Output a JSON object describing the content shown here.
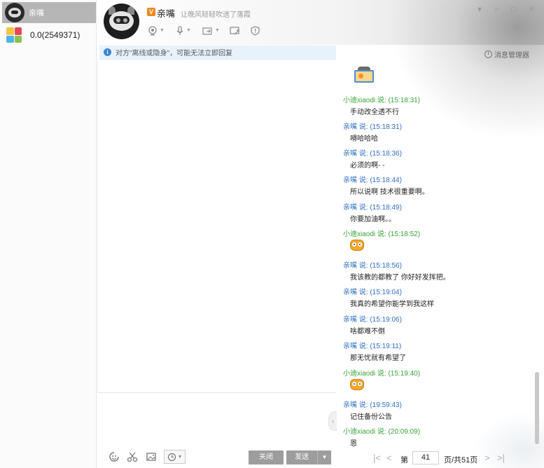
{
  "contacts": [
    {
      "name": "亲嘴",
      "active": true
    },
    {
      "name": "0.0(2549371)",
      "active": false
    }
  ],
  "header": {
    "vip_badge": "V",
    "name": "亲嘴",
    "signature": "让晚风轻轻吹送了落霞"
  },
  "window_controls": {
    "menu": "▾",
    "minimize": "−",
    "maximize": "□",
    "close": "×"
  },
  "notice": {
    "info_glyph": "i",
    "text": "对方\"离线或隐身\"，可能无法立即回复"
  },
  "history_tab": {
    "label": "消息管理器"
  },
  "messages": [
    {
      "sender": "小迪xiaodi 说: (15:18:31)",
      "color": "green",
      "text": "手动改全透不行"
    },
    {
      "sender": "亲嘴 说: (15:18:31)",
      "color": "blue",
      "text": "嘚哈哈哈"
    },
    {
      "sender": "亲嘴 说: (15:18:36)",
      "color": "blue",
      "text": "必须的啊- -"
    },
    {
      "sender": "亲嘴 说: (15:18:44)",
      "color": "blue",
      "text": "所以说啊  技术很重要啊。"
    },
    {
      "sender": "亲嘴 说: (15:18:49)",
      "color": "blue",
      "text": "你要加油啊。。"
    },
    {
      "sender": "小迪xiaodi 说: (15:18:52)",
      "color": "green",
      "emoji": "owl-emoji"
    },
    {
      "sender": "亲嘴 说: (15:18:56)",
      "color": "blue",
      "text": "我该教的都教了  你好好发挥把。"
    },
    {
      "sender": "亲嘴 说: (15:19:04)",
      "color": "blue",
      "text": "我真的希望你能学到我这样"
    },
    {
      "sender": "亲嘴 说: (15:19:06)",
      "color": "blue",
      "text": "啥都难不倒"
    },
    {
      "sender": "亲嘴 说: (15:19:11)",
      "color": "blue",
      "text": "那无忧就有希望了"
    },
    {
      "sender": "小迪xiaodi 说: (15:19:40)",
      "color": "green",
      "emoji": "owl-emoji"
    },
    {
      "sender": "亲嘴 说: (19:59:43)",
      "color": "blue",
      "text": "记住备份公告"
    },
    {
      "sender": "小迪xiaodi 说: (20:09:09)",
      "color": "green",
      "text": "恩"
    }
  ],
  "input": {
    "close_label": "关闭",
    "send_label": "发送"
  },
  "pager": {
    "first": "|<",
    "prev": "<",
    "next": ">",
    "last": ">|",
    "page_prefix": "第",
    "current_page": "41",
    "page_suffix": "页/共51页"
  }
}
